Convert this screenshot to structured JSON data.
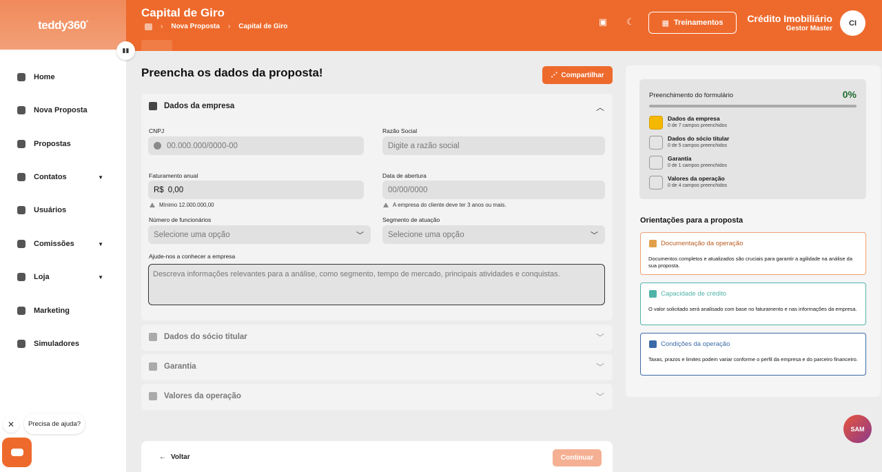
{
  "header": {
    "logo": "teddy360",
    "logo_sup": "°",
    "title": "Capital de Giro",
    "breadcrumb": [
      "Nova Proposta",
      "Capital de Giro"
    ],
    "breadcrumb_sep": "›",
    "trainings_label": "Treinamentos",
    "user_name": "Crédito Imobiliário",
    "user_role": "Gestor Master",
    "avatar_initials": "CI",
    "accent_color": "#ee6a2c"
  },
  "sidebar": {
    "items": [
      {
        "label": "Home",
        "icon": "home-icon"
      },
      {
        "label": "Nova Proposta",
        "icon": "new-proposal-icon"
      },
      {
        "label": "Propostas",
        "icon": "proposals-icon"
      },
      {
        "label": "Contatos",
        "icon": "contacts-icon",
        "caret": "▼"
      },
      {
        "label": "Usuários",
        "icon": "users-icon"
      },
      {
        "label": "Comissões",
        "icon": "commissions-icon",
        "caret": "▼"
      },
      {
        "label": "Loja",
        "icon": "store-icon",
        "caret": "▼"
      },
      {
        "label": "Marketing",
        "icon": "marketing-icon"
      },
      {
        "label": "Simuladores",
        "icon": "simulators-icon"
      }
    ],
    "help_text": "Precisa de ajuda?",
    "close_glyph": "✕"
  },
  "form": {
    "heading": "Preencha os dados da proposta!",
    "share_label": "Compartilhar",
    "company_section": {
      "title": "Dados da empresa",
      "cnpj_label": "CNPJ",
      "cnpj_placeholder": "00.000.000/0000-00",
      "razao_label": "Razão Social",
      "razao_placeholder": "Digite a razão social",
      "faturamento_label": "Faturamento anual",
      "faturamento_prefix": "R$",
      "faturamento_value": "0,00",
      "faturamento_hint": "Mínimo 12.000.000,00",
      "abertura_label": "Data de abertura",
      "abertura_placeholder": "00/00/0000",
      "abertura_hint": "A empresa do cliente deve ter 3 anos ou mais.",
      "funcionarios_label": "Número de funcionários",
      "funcionarios_placeholder": "Selecione uma opção",
      "segmento_label": "Segmento de atuação",
      "segmento_placeholder": "Selecione uma opção",
      "sobre_label": "Ajude-nos a conhecer a empresa",
      "sobre_placeholder": "Descreva informações relevantes para a análise, como segmento, tempo de mercado, principais atividades e conquistas."
    },
    "collapsed_sections": [
      "Dados do sócio titular",
      "Garantia",
      "Valores da operação"
    ],
    "back_label": "Voltar",
    "continue_label": "Continuar"
  },
  "progress": {
    "title": "Preenchimento do formulário",
    "percent_label": "0%",
    "percent_value": 0,
    "steps": [
      {
        "title": "Dados da empresa",
        "sub": "0 de 7 campos preenchidos"
      },
      {
        "title": "Dados do sócio titular",
        "sub": "0 de 5 campos preenchidos"
      },
      {
        "title": "Garantia",
        "sub": "0 de 1 campos preenchidos"
      },
      {
        "title": "Valores da operação",
        "sub": "0 de 4 campos preenchidos"
      }
    ]
  },
  "orientations": {
    "title": "Orientações para a proposta",
    "cards": [
      {
        "title": "Documentação da operação",
        "text": "Documentos completos e atualizados são cruciais para garantir a agilidade na análise da sua proposta.",
        "color": "#f0a070"
      },
      {
        "title": "Capacidade de crédito",
        "text": "O valor solicitado será analisado com base no faturamento e nas informações da empresa.",
        "color": "#4fb3a8"
      },
      {
        "title": "Condições da operação",
        "text": "Taxas, prazos e limites podem variar conforme o perfil da empresa e do parceiro financeiro.",
        "color": "#3b6aa8"
      }
    ]
  },
  "assistant_label": "SAM"
}
